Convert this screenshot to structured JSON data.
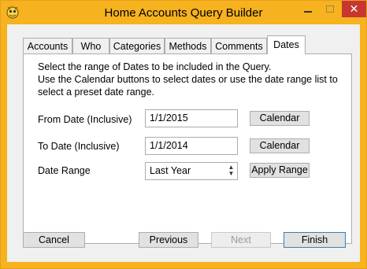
{
  "window": {
    "title": "Home Accounts Query Builder"
  },
  "titlebar": {
    "close_glyph": "✕"
  },
  "tabs": [
    {
      "label": "Accounts"
    },
    {
      "label": "Who"
    },
    {
      "label": "Categories"
    },
    {
      "label": "Methods"
    },
    {
      "label": "Comments"
    },
    {
      "label": "Dates"
    }
  ],
  "dates_panel": {
    "instructions": [
      "Select the range of Dates to be included in the Query.",
      "Use the Calendar buttons to select dates or use the date range list to",
      "select a preset date range."
    ],
    "from_label": "From Date (Inclusive)",
    "from_value": "1/1/2015",
    "to_label": "To Date (Inclusive)",
    "to_value": "1/1/2014",
    "calendar_label": "Calendar",
    "range_label": "Date Range",
    "range_value": "Last Year",
    "apply_label": "Apply Range"
  },
  "footer": {
    "cancel": "Cancel",
    "previous": "Previous",
    "next": "Next",
    "finish": "Finish"
  },
  "colors": {
    "frame": "#F7B21F",
    "close": "#C7372F",
    "panel": "#FFFFFF",
    "client": "#F0F0F0"
  }
}
